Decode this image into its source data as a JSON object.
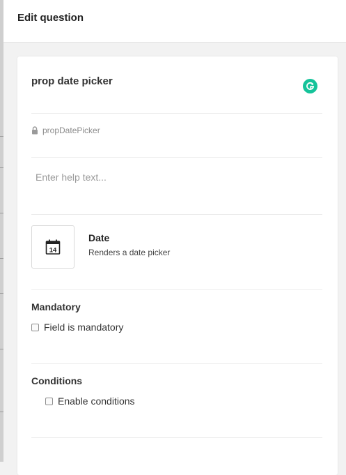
{
  "header": {
    "title": "Edit question"
  },
  "question": {
    "title": "prop date picker",
    "key": "propDatePicker",
    "help_placeholder": "Enter help text...",
    "help_value": ""
  },
  "field_type": {
    "icon": "calendar-icon",
    "icon_day": "14",
    "name": "Date",
    "description": "Renders a date picker"
  },
  "mandatory": {
    "label": "Mandatory",
    "checkbox_label": "Field is mandatory",
    "checked": false
  },
  "conditions": {
    "label": "Conditions",
    "checkbox_label": "Enable conditions",
    "checked": false
  },
  "colors": {
    "grammarly_badge": "#15c39a",
    "header_bg": "#ffffff",
    "page_bg": "#f2f2f2"
  }
}
